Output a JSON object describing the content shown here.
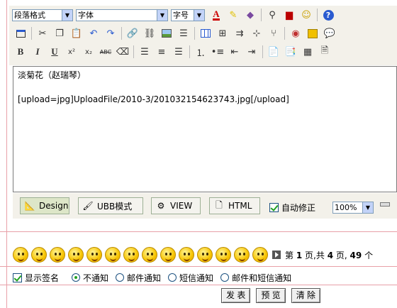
{
  "toolbar": {
    "paragraph_select": "段落格式",
    "font_select": "字体",
    "size_select": "字号",
    "bold": "B",
    "italic": "I",
    "underline": "U"
  },
  "editor": {
    "lines": [
      "淡菊花（赵瑞琴）",
      "",
      "[upload=jpg]UploadFile/2010-3/201032154623743.jpg[/upload]"
    ]
  },
  "modebar": {
    "design_label": "Design",
    "ubb_label": "UBB模式",
    "view_label": "VIEW",
    "html_label": "HTML",
    "autofix_label": "自动修正",
    "zoom": "100%"
  },
  "pager": {
    "prefix": "第",
    "page": "1",
    "mid": "页,共",
    "total": "4",
    "suffix": "页,",
    "count": "49",
    "tail": "个"
  },
  "options": {
    "show_signature": "显示签名",
    "notify_none": "不通知",
    "notify_email": "邮件通知",
    "notify_sms": "短信通知",
    "notify_both": "邮件和短信通知"
  },
  "actions": {
    "submit": "发 表",
    "preview": "预 览",
    "clear": "清 除"
  },
  "colors": {
    "frame": "#e8a0a8",
    "toolbar_bg": "#f3f1ea",
    "check_green": "#21a121"
  }
}
